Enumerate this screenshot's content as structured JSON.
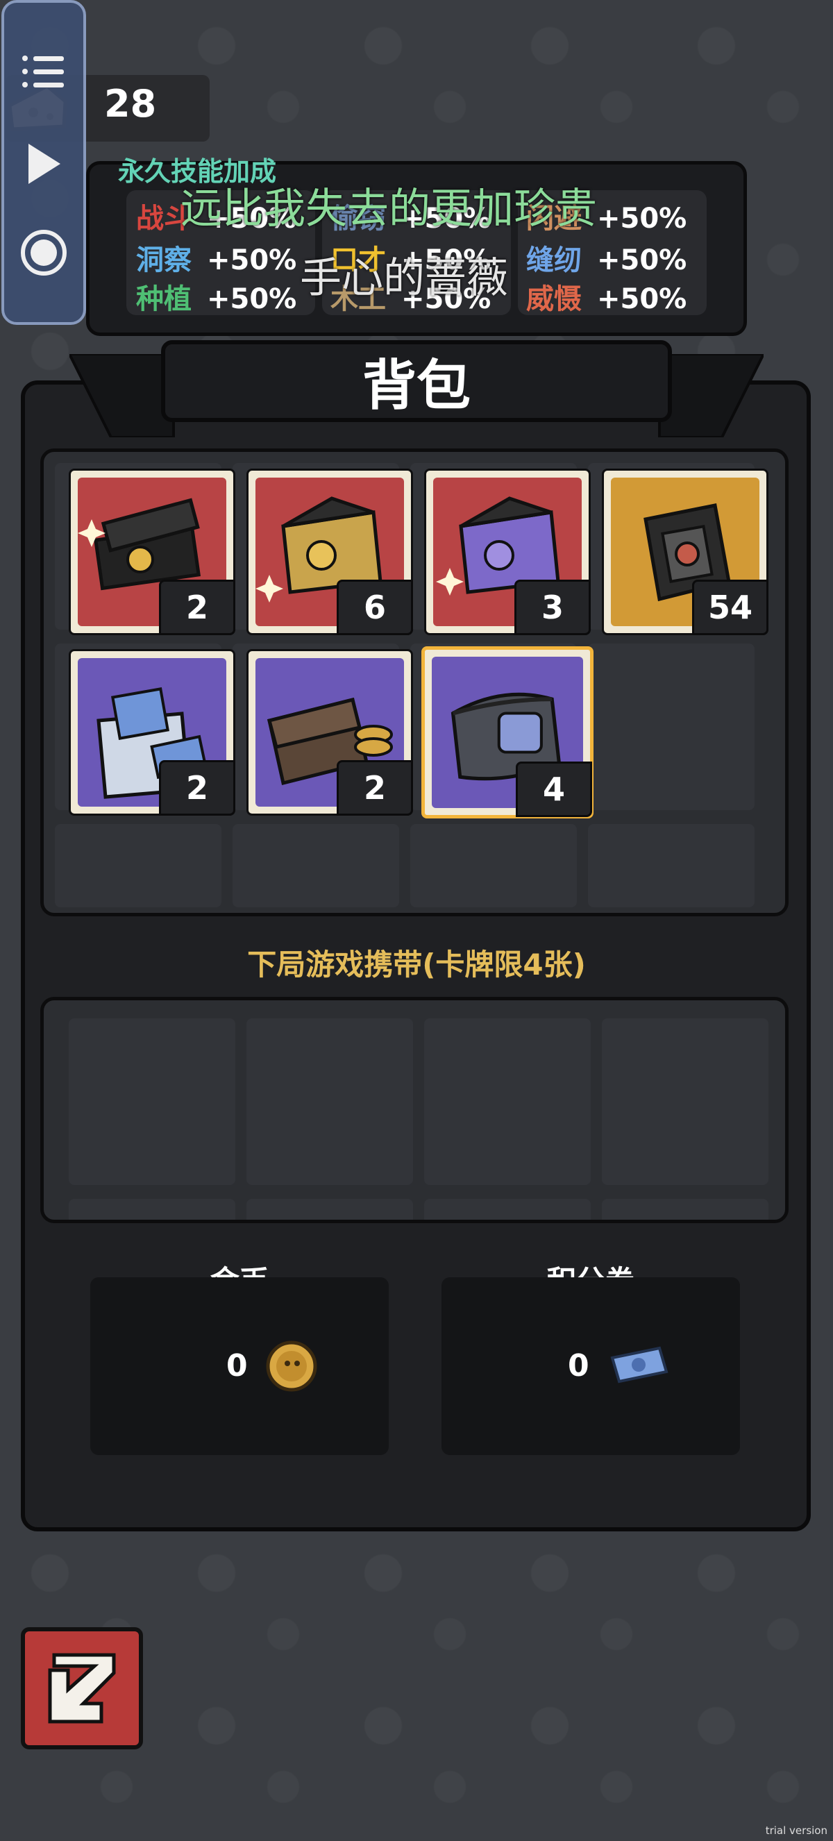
{
  "resource": {
    "value": "28",
    "icon": "cheese-icon"
  },
  "side_toolbar": {
    "icons": [
      "list-icon",
      "play-icon",
      "record-icon"
    ]
  },
  "skills": {
    "title": "永久技能加成",
    "rows": [
      {
        "name": "战斗",
        "value": "+50%",
        "color": "#d8463f"
      },
      {
        "name": "洞察",
        "value": "+50%",
        "color": "#5fb0e8"
      },
      {
        "name": "种植",
        "value": "+50%",
        "color": "#4fbf74"
      },
      {
        "name": "偷窃",
        "value": "+50%",
        "color": "#6a86b0"
      },
      {
        "name": "口才",
        "value": "+50%",
        "color": "#f0c12f"
      },
      {
        "name": "木工",
        "value": "+50%",
        "color": "#b89a6a"
      },
      {
        "name": "闪避",
        "value": "+50%",
        "color": "#d09060"
      },
      {
        "name": "缝纫",
        "value": "+50%",
        "color": "#6fa5e8"
      },
      {
        "name": "威慑",
        "value": "+50%",
        "color": "#e0674a"
      }
    ]
  },
  "overlay": {
    "line1": "远比我失去的更加珍贵",
    "line2": "手心的蔷薇"
  },
  "backpack": {
    "title": "背包",
    "items": [
      {
        "name": "gold-gift-box",
        "count": "2",
        "bg": "red"
      },
      {
        "name": "gold-card-pack",
        "count": "6",
        "bg": "red"
      },
      {
        "name": "purple-card-pack",
        "count": "3",
        "bg": "red"
      },
      {
        "name": "black-card-box",
        "count": "54",
        "bg": "gold"
      },
      {
        "name": "blue-ticket-bag",
        "count": "2",
        "bg": "purple"
      },
      {
        "name": "coin-wallet",
        "count": "2",
        "bg": "purple"
      },
      {
        "name": "gray-pouch",
        "count": "4",
        "bg": "purple",
        "selected": true
      }
    ]
  },
  "carry": {
    "label": "下局游戏携带(卡牌限4张)"
  },
  "currencies": [
    {
      "title": "金币",
      "value": "0",
      "icon": "gold-coin-icon"
    },
    {
      "title": "积分券",
      "value": "0",
      "icon": "ticket-icon"
    }
  ],
  "back_button": {
    "icon": "back-arrow-icon"
  },
  "watermark": "trial version"
}
